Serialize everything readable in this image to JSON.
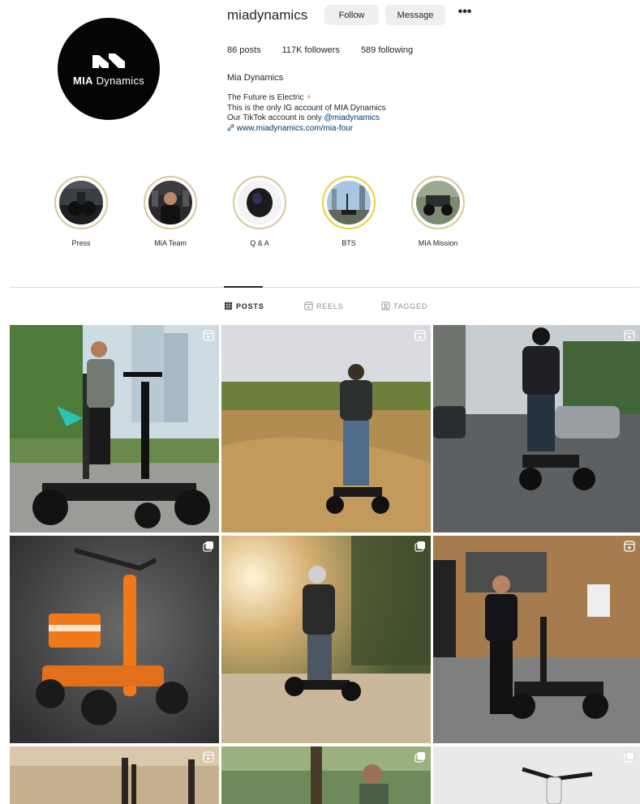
{
  "profile": {
    "username": "miadynamics",
    "follow_label": "Follow",
    "message_label": "Message",
    "more_label": "•••",
    "logo_bold": "MIA",
    "logo_light": " Dynamics",
    "stats": {
      "posts": "86 posts",
      "followers": "117K followers",
      "following": "589 following"
    },
    "full_name": "Mia Dynamics",
    "bio": {
      "line1": "The Future is Electric",
      "line1_emoji": "⚡",
      "line2": "This is the only IG account of MIA Dynamics",
      "line3_prefix": "Our TikTok account is only ",
      "line3_mention": "@miadynamics",
      "link_icon": "🔗",
      "link": "www.miadynamics.com/mia-four"
    }
  },
  "highlights": [
    {
      "label": "Press",
      "icon": "press-highlight"
    },
    {
      "label": "MIA Team",
      "icon": "team-highlight"
    },
    {
      "label": "Q & A",
      "icon": "qa-highlight"
    },
    {
      "label": "BTS",
      "icon": "bts-highlight"
    },
    {
      "label": "MIA Mission",
      "icon": "mission-highlight"
    }
  ],
  "tabs": [
    {
      "label": "POSTS",
      "icon": "grid-icon",
      "active": true
    },
    {
      "label": "REELS",
      "icon": "reels-icon",
      "active": false
    },
    {
      "label": "TAGGED",
      "icon": "tagged-icon",
      "active": false
    }
  ],
  "posts": [
    {
      "scene": "man-standing-scooter-palm-street",
      "badge": "reel-icon"
    },
    {
      "scene": "rider-offroad-dirt-track",
      "badge": "reel-icon"
    },
    {
      "scene": "rider-wet-city-street",
      "badge": "reel-icon"
    },
    {
      "scene": "orange-scooter-studio",
      "badge": "carousel-icon"
    },
    {
      "scene": "rider-sunset-forest-trail",
      "badge": "carousel-icon"
    },
    {
      "scene": "man-brick-wall-scooter",
      "badge": "reel-icon"
    },
    {
      "scene": "desert-riders",
      "badge": "reel-icon"
    },
    {
      "scene": "man-trees-scooter",
      "badge": "carousel-icon"
    },
    {
      "scene": "scooter-handlebar-white",
      "badge": "carousel-icon"
    }
  ],
  "colors": {
    "button_bg": "#efefef",
    "text": "#262626",
    "muted": "#8e8e8e",
    "link": "#00376b",
    "highlight_ring": "#d6c99a",
    "orange_accent": "#f07a1a"
  }
}
